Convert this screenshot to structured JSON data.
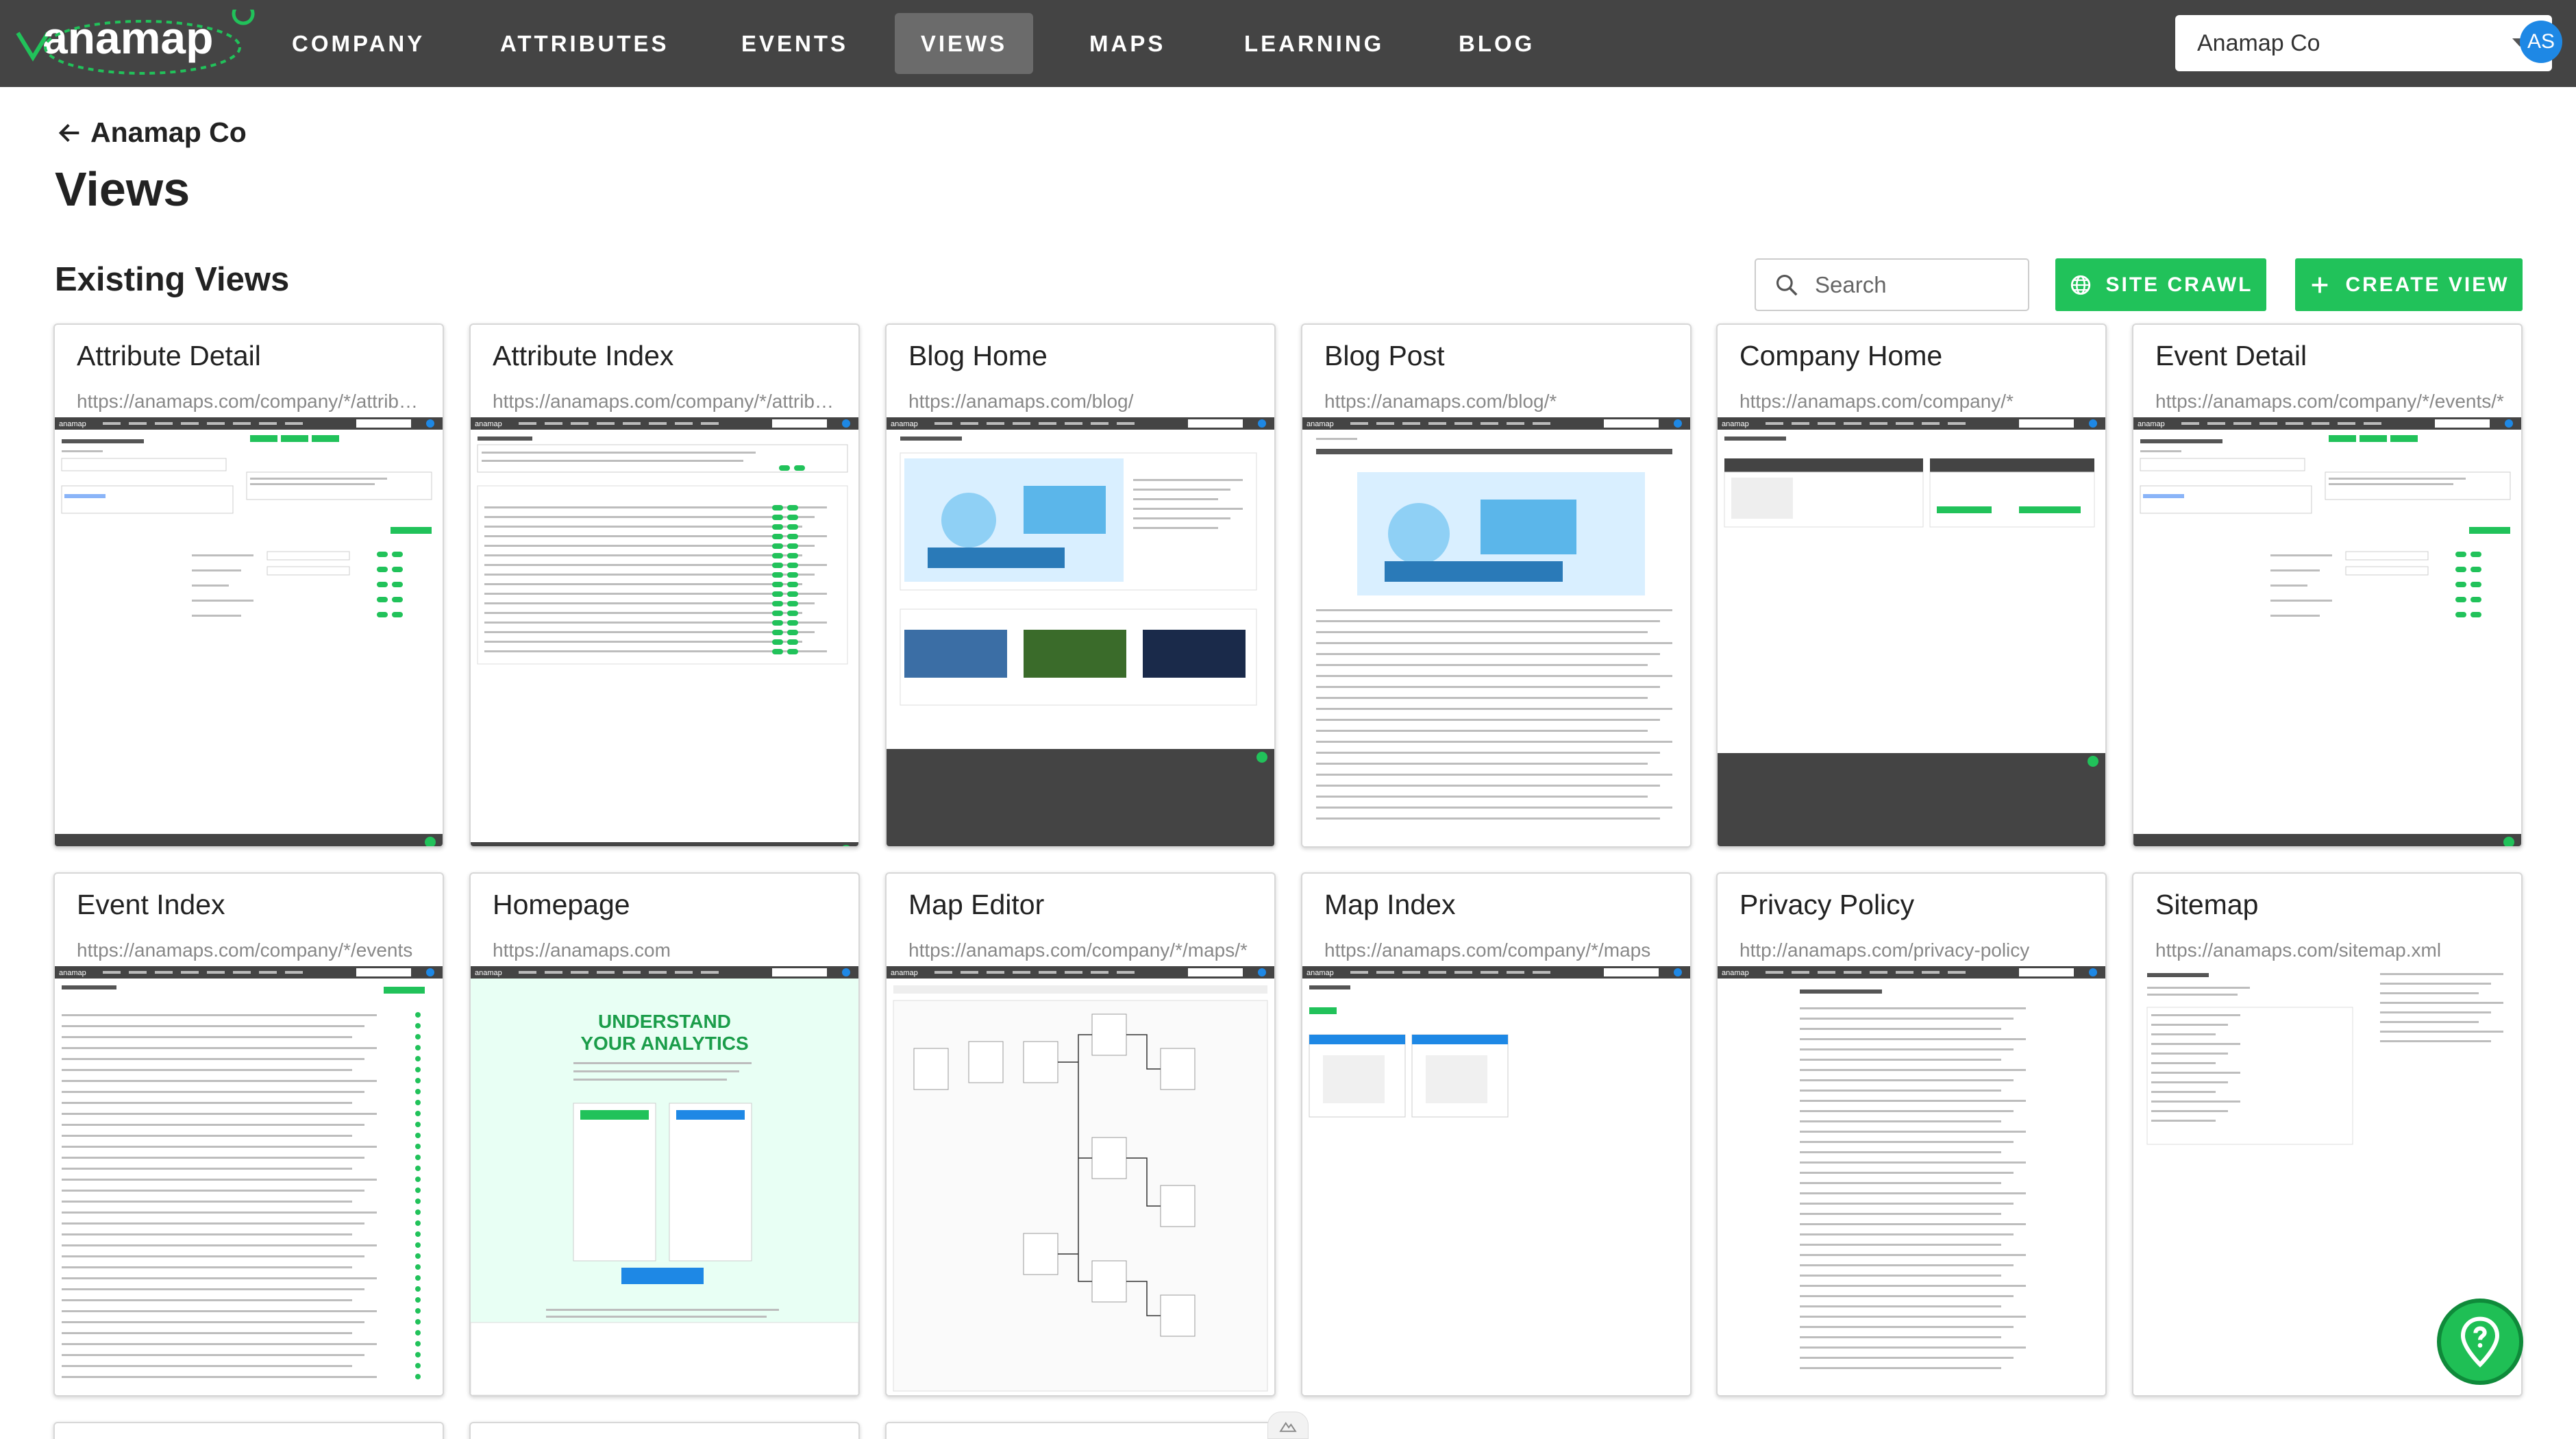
{
  "brand": {
    "name": "anamap",
    "accent": "#21c25a",
    "nav_bg": "#444444"
  },
  "nav": {
    "items": [
      {
        "label": "COMPANY"
      },
      {
        "label": "ATTRIBUTES"
      },
      {
        "label": "EVENTS"
      },
      {
        "label": "VIEWS",
        "active": true
      },
      {
        "label": "MAPS"
      },
      {
        "label": "LEARNING"
      },
      {
        "label": "BLOG"
      }
    ],
    "company_select": "Anamap Co",
    "avatar_initials": "AS"
  },
  "header": {
    "back_label": "Anamap Co",
    "title": "Views",
    "section_title": "Existing Views"
  },
  "toolbar": {
    "search_placeholder": "Search",
    "site_crawl_label": "SITE CRAWL",
    "create_view_label": "CREATE VIEW"
  },
  "views": [
    {
      "title": "Attribute Detail",
      "url": "https://anamaps.com/company/*/attributes/*",
      "thumb": "detail"
    },
    {
      "title": "Attribute Index",
      "url": "https://anamaps.com/company/*/attributes",
      "thumb": "index"
    },
    {
      "title": "Blog Home",
      "url": "https://anamaps.com/blog/",
      "thumb": "bloghome"
    },
    {
      "title": "Blog Post",
      "url": "https://anamaps.com/blog/*",
      "thumb": "blogpost"
    },
    {
      "title": "Company Home",
      "url": "https://anamaps.com/company/*",
      "thumb": "company"
    },
    {
      "title": "Event Detail",
      "url": "https://anamaps.com/company/*/events/*",
      "thumb": "detail"
    },
    {
      "title": "Event Index",
      "url": "https://anamaps.com/company/*/events",
      "thumb": "eventindex"
    },
    {
      "title": "Homepage",
      "url": "https://anamaps.com",
      "thumb": "homepage"
    },
    {
      "title": "Map Editor",
      "url": "https://anamaps.com/company/*/maps/*",
      "thumb": "mapeditor"
    },
    {
      "title": "Map Index",
      "url": "https://anamaps.com/company/*/maps",
      "thumb": "mapindex"
    },
    {
      "title": "Privacy Policy",
      "url": "http://anamaps.com/privacy-policy",
      "thumb": "privacy"
    },
    {
      "title": "Sitemap",
      "url": "https://anamaps.com/sitemap.xml",
      "thumb": "sitemap"
    }
  ],
  "icons": {
    "back": "arrow-left-icon",
    "search": "search-icon",
    "crawl": "globe-icon",
    "create": "plus-icon",
    "help": "map-pin-question-icon"
  }
}
